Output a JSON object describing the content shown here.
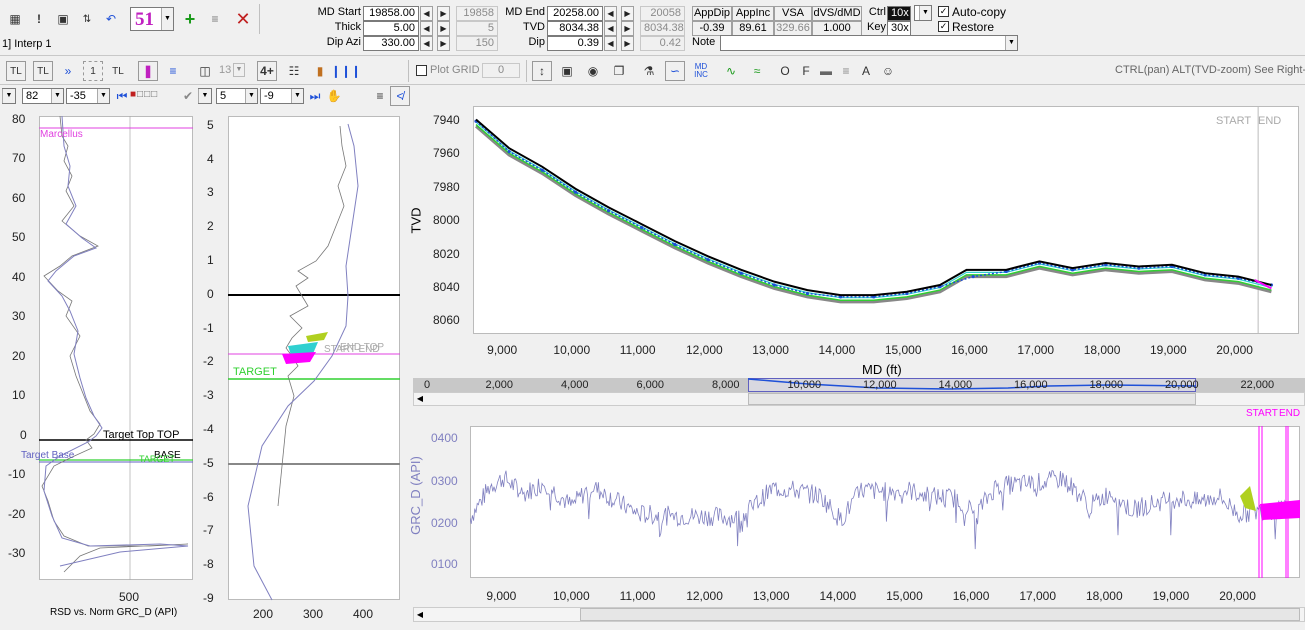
{
  "header": {
    "interp_label": "1] Interp 1",
    "counter": "51",
    "md_start_label": "MD Start",
    "md_start": "19858.00",
    "md_start_ref": "19858",
    "thick_label": "Thick",
    "thick": "5.00",
    "thick_ref": "5",
    "dip_azi_label": "Dip Azi",
    "dip_azi": "330.00",
    "dip_azi_ref": "150",
    "md_end_label": "MD End",
    "md_end": "20258.00",
    "md_end_ref": "20058",
    "tvd_label": "TVD",
    "tvd": "8034.38",
    "tvd_ref": "8034.38",
    "dip_label": "Dip",
    "dip": "0.39",
    "dip_ref": "0.42",
    "grid_headers": [
      "AppDip",
      "AppInc",
      "VSA",
      "dVS/dMD"
    ],
    "grid_values": [
      "-0.39",
      "89.61",
      "329.66",
      "1.000"
    ],
    "ctrl_label": "Ctrl",
    "ctrl_value": "10x",
    "key_label": "Key",
    "key_value": "30x",
    "autocopy_label": "Auto-copy",
    "restore_label": "Restore",
    "note_label": "Note",
    "note_value": ""
  },
  "toolbar2": {
    "tl": "TL",
    "tl2": "TL",
    "one": "1",
    "tl3": "TL",
    "num13": "13",
    "four_plus": "4+",
    "plot_grid_label": "Plot GRID",
    "plot_grid_value": "0",
    "md_inc": "MD\nINC",
    "o": "O",
    "f": "F",
    "a": "A",
    "hint": "CTRL(pan) ALT(TVD-zoom) See Right-Cl"
  },
  "toolbar3": {
    "sel1": "82",
    "sel2": "-35",
    "sel3": "5",
    "sel4": "-9"
  },
  "left_track": {
    "yticks": [
      "80",
      "70",
      "60",
      "50",
      "40",
      "30",
      "20",
      "10",
      "0",
      "-10",
      "-20",
      "-30"
    ],
    "xticks": [
      "500"
    ],
    "footer": "RSD vs. Norm GRC_D (API)",
    "labels": {
      "marcellus": "Marcellus",
      "target_top": "Target Top TOP",
      "target_base": "Target Base",
      "base": "BASE",
      "target_small": "TARGET"
    }
  },
  "mid_track": {
    "yticks": [
      "5",
      "4",
      "3",
      "2",
      "1",
      "0",
      "-1",
      "-2",
      "-3",
      "-4",
      "-5",
      "-6",
      "-7",
      "-8",
      "-9"
    ],
    "xticks": [
      "200",
      "300",
      "400"
    ],
    "labels": {
      "target": "TARGET",
      "start_end": "START END",
      "end_top": "END TOP"
    }
  },
  "tvd_chart": {
    "ylabel": "TVD",
    "xlabel": "MD (ft)",
    "yticks": [
      "7940",
      "7960",
      "7980",
      "8000",
      "8020",
      "8040",
      "8060"
    ],
    "xticks": [
      "9,000",
      "10,000",
      "11,000",
      "12,000",
      "13,000",
      "14,000",
      "15,000",
      "16,000",
      "17,000",
      "18,000",
      "19,000",
      "20,000"
    ],
    "start_label": "START",
    "end_label": "END"
  },
  "overview": {
    "ticks": [
      "0",
      "2,000",
      "4,000",
      "6,000",
      "8,000",
      "10,000",
      "12,000",
      "14,000",
      "16,000",
      "18,000",
      "20,000",
      "22,000"
    ]
  },
  "gr_chart": {
    "ylabel": "GRC_D (API)",
    "yticks": [
      "0400",
      "0300",
      "0200",
      "0100"
    ],
    "xticks": [
      "9,000",
      "10,000",
      "11,000",
      "12,000",
      "13,000",
      "14,000",
      "15,000",
      "16,000",
      "17,000",
      "18,000",
      "19,000",
      "20,000"
    ],
    "start_label": "START",
    "end_label": "END"
  },
  "colors": {
    "accent_gr": "#8080c0",
    "marcellus": "#e040e0",
    "target_green": "#30d030",
    "wellpath_blue": "#1e50d8",
    "marker_magenta": "#ff00ff"
  },
  "chart_data": [
    {
      "type": "line",
      "title": "",
      "xlabel": "MD (ft)",
      "ylabel": "TVD",
      "xlim": [
        8500,
        20500
      ],
      "ylim": [
        8065,
        7930
      ],
      "series": [
        {
          "x": [
            8500,
            9000,
            9500,
            10000,
            10500,
            11000,
            11500,
            12000,
            12500,
            13000,
            13500,
            14000,
            14500,
            15000,
            15500,
            15900,
            16500,
            17000,
            17500,
            18000,
            18500,
            19000,
            19500,
            20000,
            20500
          ],
          "values": [
            7938,
            7955,
            7966,
            7979,
            7990,
            8000,
            8010,
            8019,
            8027,
            8034,
            8039,
            8042,
            8042,
            8040,
            8036,
            8027,
            8027,
            8022,
            8026,
            8023,
            8025,
            8024,
            8029,
            8031,
            8036
          ]
        },
        {
          "x": [
            8500,
            9000,
            9500,
            10000,
            10500,
            11000,
            11500,
            12000,
            12500,
            13000,
            13500,
            14000,
            14500,
            15000,
            15500,
            16000,
            16500,
            17000,
            17500,
            18000,
            18500,
            19000,
            19500,
            20000,
            20500
          ],
          "values": [
            7939,
            7957,
            7968,
            7981,
            7992,
            8002,
            8012,
            8021,
            8029,
            8036,
            8041,
            8043,
            8043,
            8041,
            8037,
            8031,
            8028,
            8023,
            8027,
            8024,
            8026,
            8025,
            8030,
            8032,
            8036
          ]
        }
      ]
    },
    {
      "type": "line",
      "title": "",
      "xlabel": "",
      "ylabel": "GRC_D (API)",
      "xlim": [
        8500,
        20500
      ],
      "ylim": [
        50,
        430
      ],
      "series": [
        {
          "x": [
            8500,
            8800,
            9000,
            9300,
            9600,
            10000,
            10300,
            10600,
            11000,
            11500,
            12000,
            12500,
            13000,
            13300,
            13700,
            14000,
            14300,
            14700,
            15000,
            15300,
            15700,
            16000,
            16300,
            16700,
            17000,
            17300,
            17700,
            18000,
            18300,
            18700,
            19000,
            19300,
            19600,
            19700,
            19900,
            20300
          ],
          "values": [
            200,
            280,
            300,
            260,
            290,
            230,
            280,
            250,
            210,
            205,
            205,
            200,
            275,
            270,
            255,
            195,
            270,
            265,
            270,
            255,
            250,
            210,
            280,
            285,
            290,
            300,
            230,
            265,
            220,
            240,
            250,
            240,
            255,
            240,
            210,
            220
          ]
        }
      ]
    }
  ]
}
